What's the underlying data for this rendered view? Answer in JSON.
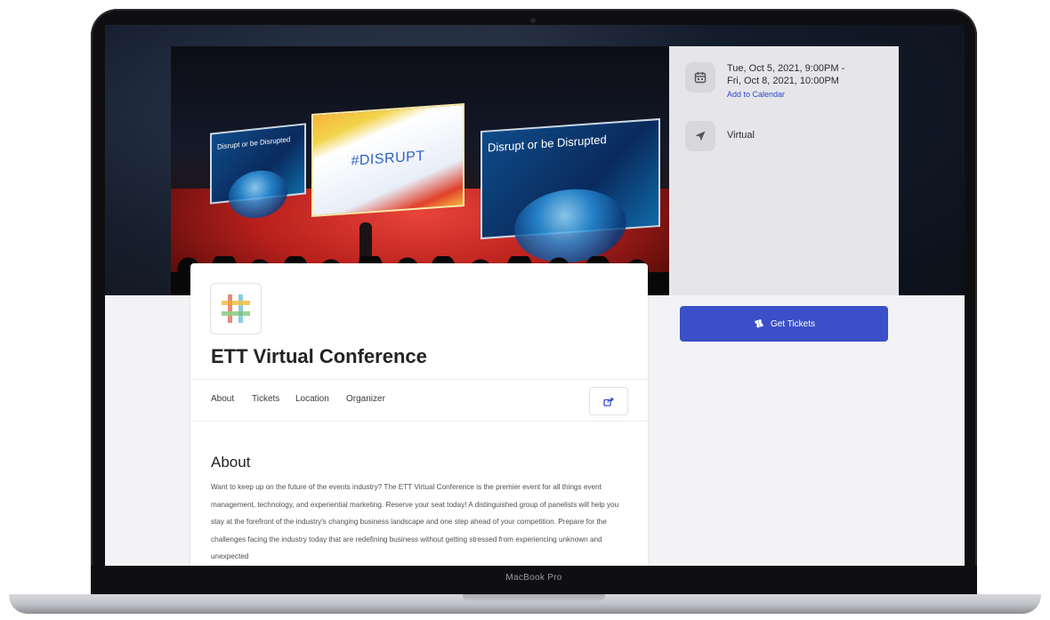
{
  "device": {
    "model_label": "MacBook Pro"
  },
  "hero": {
    "left_screen_caption": "Disrupt or be Disrupted",
    "center_screen_caption": "#DISRUPT",
    "right_screen_caption": "Disrupt or be Disrupted"
  },
  "event": {
    "title": "ETT Virtual Conference",
    "date_line_1": "Tue, Oct 5, 2021, 9:00PM -",
    "date_line_2": "Fri, Oct 8, 2021, 10:00PM",
    "add_to_calendar": "Add to Calendar",
    "location": "Virtual",
    "get_tickets": "Get Tickets"
  },
  "tabs": [
    {
      "label": "About"
    },
    {
      "label": "Tickets"
    },
    {
      "label": "Location"
    },
    {
      "label": "Organizer"
    }
  ],
  "about": {
    "heading": "About",
    "body": "Want to keep up on the future of the events industry? The ETT Virtual Conference is the premier event for all things event management, technology, and experiential marketing. Reserve your seat today! A distinguished group of panelists will help you stay at the forefront of the industry's changing business landscape and one step ahead of your competition. Prepare for the challenges facing the industry today that are redefining business without getting stressed from experiencing unknown and unexpected"
  },
  "icons": {
    "calendar": "calendar-icon",
    "location": "location-arrow-icon",
    "tickets": "ticket-icon",
    "share": "share-icon"
  },
  "colors": {
    "primary": "#3b4fc8",
    "link": "#2e49c6",
    "panel": "#e6e6ea"
  }
}
